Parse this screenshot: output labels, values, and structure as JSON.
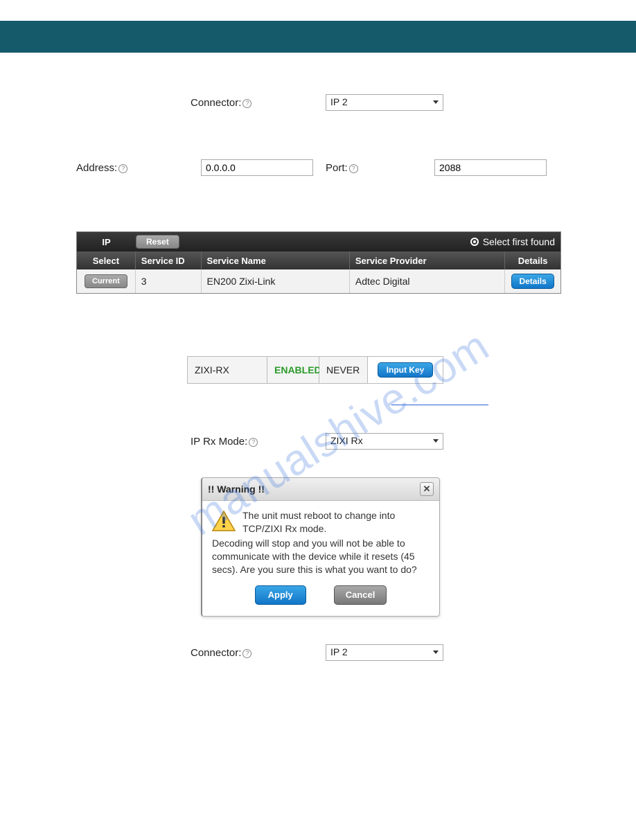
{
  "watermark": "manualshive.com",
  "fields": {
    "connector_label": "Connector:",
    "connector_value": "IP 2",
    "address_label": "Address:",
    "address_value": "0.0.0.0",
    "port_label": "Port:",
    "port_value": "2088",
    "iprx_label": "IP Rx Mode:",
    "iprx_value": "ZIXI Rx",
    "connector2_label": "Connector:",
    "connector2_value": "IP 2"
  },
  "service_table": {
    "ip_label": "IP",
    "reset": "Reset",
    "select_first_found": "Select first found",
    "headers": {
      "select": "Select",
      "service_id": "Service ID",
      "service_name": "Service Name",
      "service_provider": "Service Provider",
      "details": "Details"
    },
    "row": {
      "current": "Current",
      "service_id": "3",
      "service_name": "EN200 Zixi-Link",
      "service_provider": "Adtec Digital",
      "details": "Details"
    }
  },
  "zixi": {
    "name": "ZIXI-RX",
    "status": "ENABLED",
    "expires": "NEVER",
    "input_key": "Input Key"
  },
  "dialog": {
    "title": "!! Warning !!",
    "line1": "The unit must reboot to change into TCP/ZIXI Rx mode.",
    "body": "Decoding will stop and you will not be able to communicate with the device while it resets (45 secs). Are you sure this is what you want to do?",
    "apply": "Apply",
    "cancel": "Cancel"
  }
}
